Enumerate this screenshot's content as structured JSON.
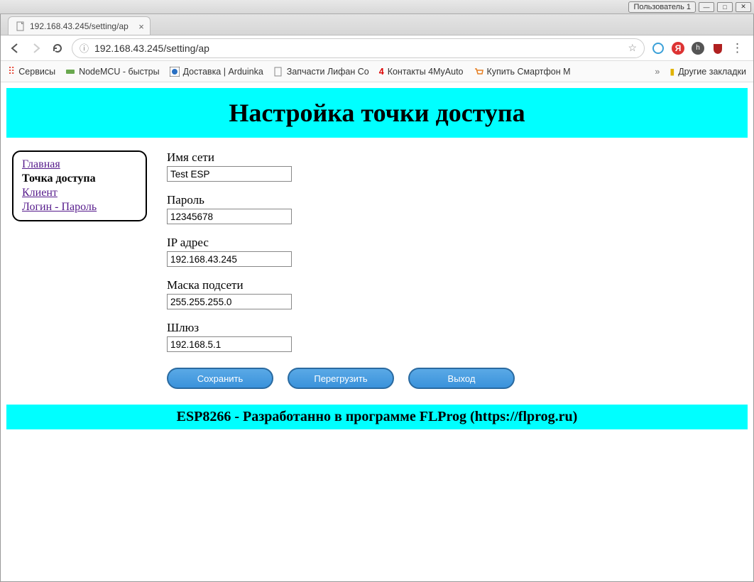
{
  "os": {
    "user_button": "Пользователь 1"
  },
  "browser": {
    "tab_title": "192.168.43.245/setting/ap",
    "url": "192.168.43.245/setting/ap",
    "bookmarks": {
      "apps": "Сервисы",
      "items": [
        "NodeMCU - быстры",
        "Доставка | Arduinka",
        "Запчасти Лифан Со",
        "Контакты 4MyAuto",
        "Купить Смартфон М"
      ],
      "other": "Другие закладки"
    }
  },
  "page": {
    "header_title": "Настройка точки доступа",
    "nav": {
      "home": "Главная",
      "ap": "Точка доступа",
      "client": "Клиент",
      "login": "Логин - Пароль"
    },
    "form": {
      "ssid_label": "Имя сети",
      "ssid_value": "Test ESP",
      "password_label": "Пароль",
      "password_value": "12345678",
      "ip_label": "IP адрес",
      "ip_value": "192.168.43.245",
      "mask_label": "Маска подсети",
      "mask_value": "255.255.255.0",
      "gateway_label": "Шлюз",
      "gateway_value": "192.168.5.1"
    },
    "buttons": {
      "save": "Сохранить",
      "reload": "Перегрузить",
      "exit": "Выход"
    },
    "footer": "ESP8266 - Разработанно в программе FLProg (https://flprog.ru)"
  }
}
